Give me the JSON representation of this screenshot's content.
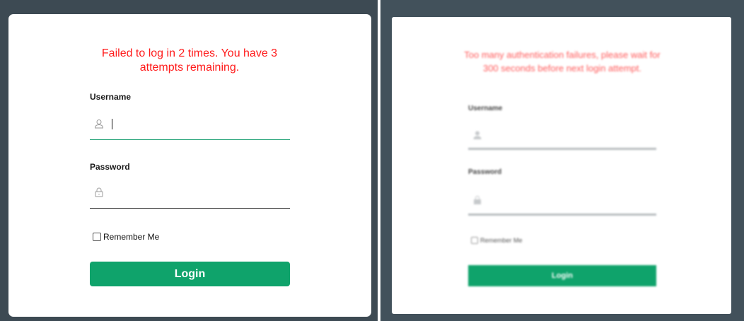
{
  "left_form": {
    "error_message": "Failed to log in 2 times. You have 3 attempts remaining.",
    "username_label": "Username",
    "username_value": "",
    "password_label": "Password",
    "password_value": "",
    "remember_label": "Remember Me",
    "remember_checked": false,
    "login_label": "Login"
  },
  "right_form": {
    "error_message": "Too many authentication failures, please wait for 300 seconds before next login attempt.",
    "username_label": "Username",
    "password_label": "Password",
    "remember_label": "Remember Me",
    "login_label": "Login"
  },
  "colors": {
    "background": "#3d4a53",
    "error": "#ff1a1a",
    "accent": "#0fa36b",
    "focus_underline": "#28a57a"
  },
  "icons": {
    "username": "user-icon",
    "password": "lock-icon"
  }
}
